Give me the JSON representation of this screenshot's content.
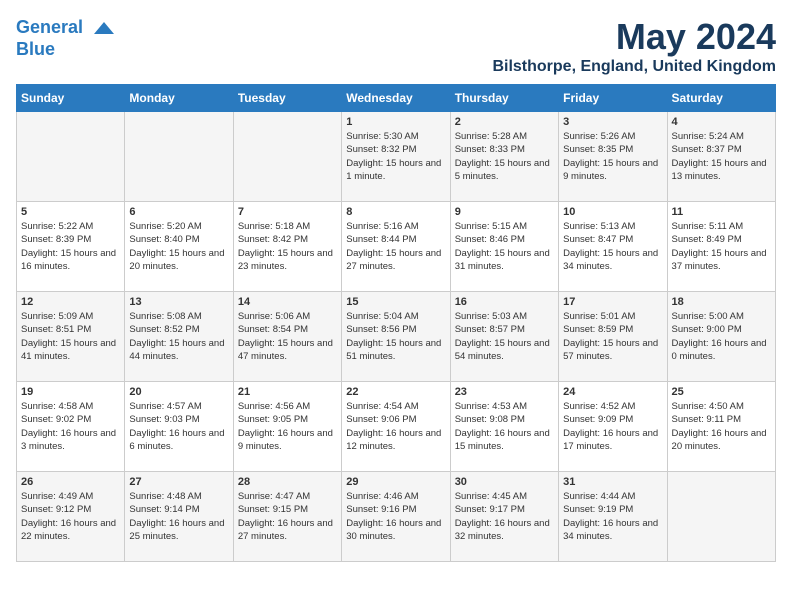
{
  "header": {
    "logo_line1": "General",
    "logo_line2": "Blue",
    "month_year": "May 2024",
    "location": "Bilsthorpe, England, United Kingdom"
  },
  "days_of_week": [
    "Sunday",
    "Monday",
    "Tuesday",
    "Wednesday",
    "Thursday",
    "Friday",
    "Saturday"
  ],
  "weeks": [
    [
      {
        "day": "",
        "content": ""
      },
      {
        "day": "",
        "content": ""
      },
      {
        "day": "",
        "content": ""
      },
      {
        "day": "1",
        "content": "Sunrise: 5:30 AM\nSunset: 8:32 PM\nDaylight: 15 hours\nand 1 minute."
      },
      {
        "day": "2",
        "content": "Sunrise: 5:28 AM\nSunset: 8:33 PM\nDaylight: 15 hours\nand 5 minutes."
      },
      {
        "day": "3",
        "content": "Sunrise: 5:26 AM\nSunset: 8:35 PM\nDaylight: 15 hours\nand 9 minutes."
      },
      {
        "day": "4",
        "content": "Sunrise: 5:24 AM\nSunset: 8:37 PM\nDaylight: 15 hours\nand 13 minutes."
      }
    ],
    [
      {
        "day": "5",
        "content": "Sunrise: 5:22 AM\nSunset: 8:39 PM\nDaylight: 15 hours\nand 16 minutes."
      },
      {
        "day": "6",
        "content": "Sunrise: 5:20 AM\nSunset: 8:40 PM\nDaylight: 15 hours\nand 20 minutes."
      },
      {
        "day": "7",
        "content": "Sunrise: 5:18 AM\nSunset: 8:42 PM\nDaylight: 15 hours\nand 23 minutes."
      },
      {
        "day": "8",
        "content": "Sunrise: 5:16 AM\nSunset: 8:44 PM\nDaylight: 15 hours\nand 27 minutes."
      },
      {
        "day": "9",
        "content": "Sunrise: 5:15 AM\nSunset: 8:46 PM\nDaylight: 15 hours\nand 31 minutes."
      },
      {
        "day": "10",
        "content": "Sunrise: 5:13 AM\nSunset: 8:47 PM\nDaylight: 15 hours\nand 34 minutes."
      },
      {
        "day": "11",
        "content": "Sunrise: 5:11 AM\nSunset: 8:49 PM\nDaylight: 15 hours\nand 37 minutes."
      }
    ],
    [
      {
        "day": "12",
        "content": "Sunrise: 5:09 AM\nSunset: 8:51 PM\nDaylight: 15 hours\nand 41 minutes."
      },
      {
        "day": "13",
        "content": "Sunrise: 5:08 AM\nSunset: 8:52 PM\nDaylight: 15 hours\nand 44 minutes."
      },
      {
        "day": "14",
        "content": "Sunrise: 5:06 AM\nSunset: 8:54 PM\nDaylight: 15 hours\nand 47 minutes."
      },
      {
        "day": "15",
        "content": "Sunrise: 5:04 AM\nSunset: 8:56 PM\nDaylight: 15 hours\nand 51 minutes."
      },
      {
        "day": "16",
        "content": "Sunrise: 5:03 AM\nSunset: 8:57 PM\nDaylight: 15 hours\nand 54 minutes."
      },
      {
        "day": "17",
        "content": "Sunrise: 5:01 AM\nSunset: 8:59 PM\nDaylight: 15 hours\nand 57 minutes."
      },
      {
        "day": "18",
        "content": "Sunrise: 5:00 AM\nSunset: 9:00 PM\nDaylight: 16 hours\nand 0 minutes."
      }
    ],
    [
      {
        "day": "19",
        "content": "Sunrise: 4:58 AM\nSunset: 9:02 PM\nDaylight: 16 hours\nand 3 minutes."
      },
      {
        "day": "20",
        "content": "Sunrise: 4:57 AM\nSunset: 9:03 PM\nDaylight: 16 hours\nand 6 minutes."
      },
      {
        "day": "21",
        "content": "Sunrise: 4:56 AM\nSunset: 9:05 PM\nDaylight: 16 hours\nand 9 minutes."
      },
      {
        "day": "22",
        "content": "Sunrise: 4:54 AM\nSunset: 9:06 PM\nDaylight: 16 hours\nand 12 minutes."
      },
      {
        "day": "23",
        "content": "Sunrise: 4:53 AM\nSunset: 9:08 PM\nDaylight: 16 hours\nand 15 minutes."
      },
      {
        "day": "24",
        "content": "Sunrise: 4:52 AM\nSunset: 9:09 PM\nDaylight: 16 hours\nand 17 minutes."
      },
      {
        "day": "25",
        "content": "Sunrise: 4:50 AM\nSunset: 9:11 PM\nDaylight: 16 hours\nand 20 minutes."
      }
    ],
    [
      {
        "day": "26",
        "content": "Sunrise: 4:49 AM\nSunset: 9:12 PM\nDaylight: 16 hours\nand 22 minutes."
      },
      {
        "day": "27",
        "content": "Sunrise: 4:48 AM\nSunset: 9:14 PM\nDaylight: 16 hours\nand 25 minutes."
      },
      {
        "day": "28",
        "content": "Sunrise: 4:47 AM\nSunset: 9:15 PM\nDaylight: 16 hours\nand 27 minutes."
      },
      {
        "day": "29",
        "content": "Sunrise: 4:46 AM\nSunset: 9:16 PM\nDaylight: 16 hours\nand 30 minutes."
      },
      {
        "day": "30",
        "content": "Sunrise: 4:45 AM\nSunset: 9:17 PM\nDaylight: 16 hours\nand 32 minutes."
      },
      {
        "day": "31",
        "content": "Sunrise: 4:44 AM\nSunset: 9:19 PM\nDaylight: 16 hours\nand 34 minutes."
      },
      {
        "day": "",
        "content": ""
      }
    ]
  ]
}
